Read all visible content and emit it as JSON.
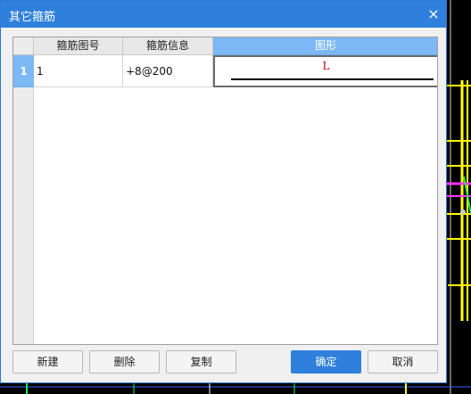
{
  "dialog": {
    "title": "其它箍筋",
    "close_glyph": "×"
  },
  "grid": {
    "columns": [
      "箍筋图号",
      "箍筋信息",
      "图形"
    ],
    "rows": [
      {
        "index": "1",
        "code": "1",
        "info": "∔8@200",
        "shape_label": "L"
      }
    ]
  },
  "buttons": {
    "new": "新建",
    "delete": "删除",
    "copy": "复制",
    "ok": "确定",
    "cancel": "取消"
  },
  "colors": {
    "accent": "#2f80dc",
    "header_selected": "#7cb7f6",
    "shape_label": "#c00000"
  }
}
